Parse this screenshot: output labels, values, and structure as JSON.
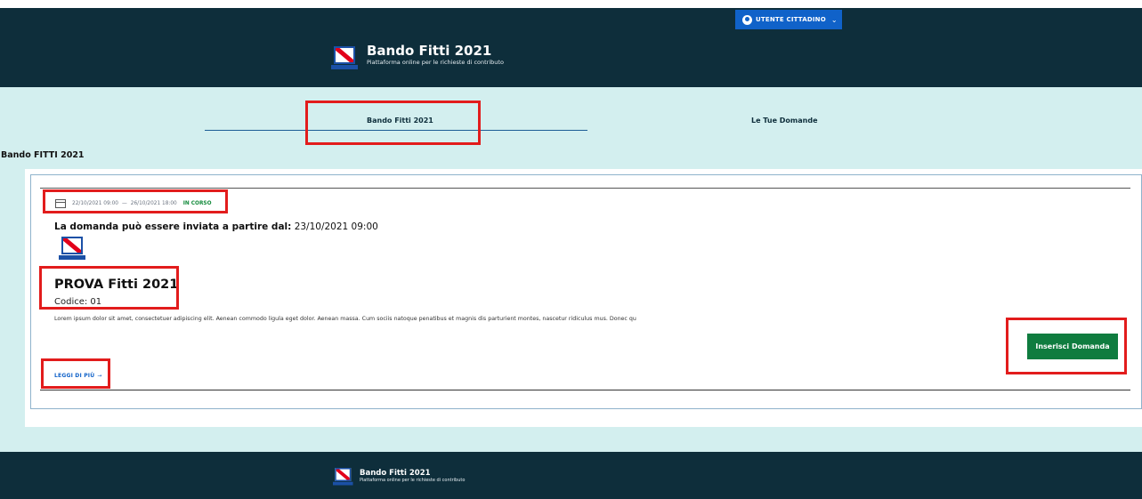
{
  "header": {
    "user_menu_label": "UTENTE CITTADINO",
    "title": "Bando Fitti 2021",
    "subtitle": "Piattaforma online per le richieste di contributo"
  },
  "tabs": [
    {
      "label": "Bando Fitti 2021",
      "active": true
    },
    {
      "label": "Le Tue Domande",
      "active": false
    }
  ],
  "section_title": "Bando FITTI 2021",
  "card": {
    "date_start": "22/10/2021 09:00",
    "date_separator": "—",
    "date_end": "26/10/2021 18:00",
    "status": "IN CORSO",
    "send_label": "La domanda può essere inviata a partire dal:",
    "send_date": "23/10/2021 09:00",
    "title": "PROVA Fitti 2021",
    "code": "Codice: 01",
    "description": "Lorem ipsum dolor sit amet, consectetuer adipiscing elit. Aenean commodo ligula eget dolor. Aenean massa. Cum sociis natoque penatibus et magnis dis parturient montes, nascetur ridiculus mus. Donec qu",
    "cta_label": "Inserisci Domanda",
    "read_more_label": "LEGGI DI PIÙ",
    "read_more_arrow": "→"
  },
  "footer": {
    "title": "Bando Fitti 2021",
    "subtitle": "Piattaforma online per le richieste di contributo"
  },
  "colors": {
    "header_bg": "#0e2e3b",
    "tab_band_bg": "#d3efef",
    "primary_blue": "#1062c9",
    "cta_green": "#0f7c3f",
    "status_green": "#138a3b",
    "highlight_red": "#e21c1c"
  },
  "icons": [
    "user-avatar-icon",
    "chevron-down-icon",
    "region-logo-icon",
    "calendar-icon",
    "arrow-right-icon"
  ]
}
